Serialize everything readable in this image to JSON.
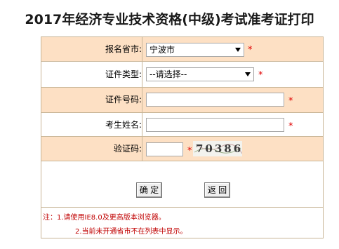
{
  "page": {
    "title": "2017年经济专业技术资格(中级)考试准考证打印"
  },
  "form": {
    "province": {
      "label": "报名省市:",
      "value": "宁波市",
      "required": "*"
    },
    "id_type": {
      "label": "证件类型:",
      "value": "--请选择--",
      "required": "*"
    },
    "id_number": {
      "label": "证件号码:",
      "value": "",
      "required": "*"
    },
    "name": {
      "label": "考生姓名:",
      "value": "",
      "required": "*"
    },
    "captcha": {
      "label": "验证码:",
      "value": "",
      "required": "*",
      "image_text": "70386"
    }
  },
  "buttons": {
    "confirm": "确 定",
    "back": "返 回"
  },
  "notes": {
    "line1": "注：1.请使用IE8.0及更高版本浏览器。",
    "line2": "2.当前未开通省市不在列表中显示。"
  },
  "colors": {
    "row_shade": "#fde0c4",
    "border": "#c8b597",
    "required": "#e00000",
    "note": "#c00000"
  }
}
